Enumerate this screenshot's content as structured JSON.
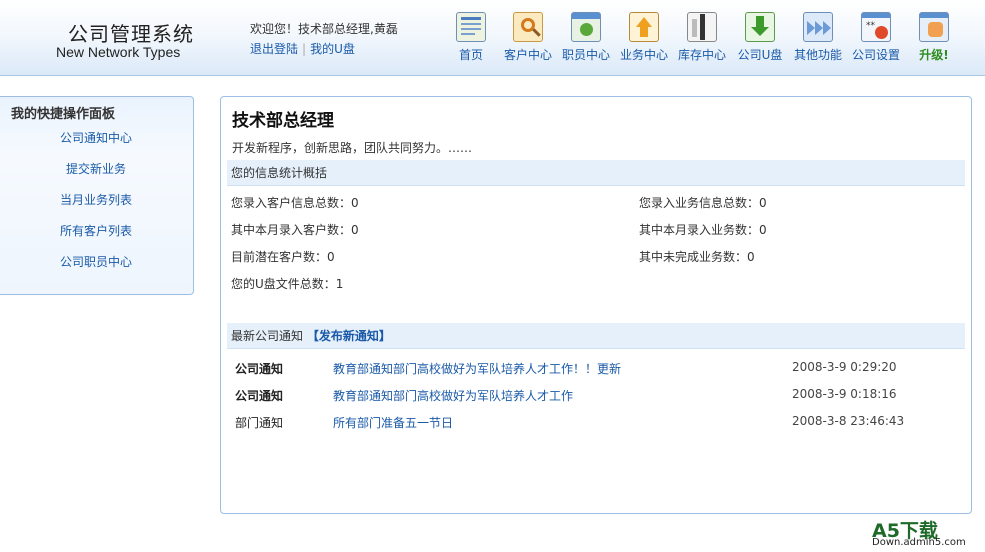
{
  "header": {
    "logo_cn": "公司管理系统",
    "logo_en": "New Network Types",
    "welcome": "欢迎您！技术部总经理,黄磊",
    "logout": "退出登陆",
    "separator": "|",
    "my_disk": "我的U盘",
    "nav": [
      {
        "label": "首页",
        "icon": "home-icon",
        "color": "#e8f0c8"
      },
      {
        "label": "客户中心",
        "icon": "customer-icon",
        "color": "#f5e2a8"
      },
      {
        "label": "职员中心",
        "icon": "staff-icon",
        "color": "#cfe8c8"
      },
      {
        "label": "业务中心",
        "icon": "business-icon",
        "color": "#f3c36a"
      },
      {
        "label": "库存中心",
        "icon": "inventory-icon",
        "color": "#dcdcdc"
      },
      {
        "label": "公司U盘",
        "icon": "usb-disk-icon",
        "color": "#9fd48a"
      },
      {
        "label": "其他功能",
        "icon": "other-functions-icon",
        "color": "#b8d2f0"
      },
      {
        "label": "公司设置",
        "icon": "settings-icon",
        "color": "#e9eef5"
      },
      {
        "label": "升级!",
        "icon": "upgrade-icon",
        "color": "#f6c27a"
      }
    ]
  },
  "quick_panel": {
    "title": "我的快捷操作面板",
    "items": [
      "公司通知中心",
      "提交新业务",
      "当月业务列表",
      "所有客户列表",
      "公司职员中心"
    ]
  },
  "main": {
    "title": "技术部总经理",
    "slogan": "开发新程序，创新思路，团队共同努力。……",
    "stats_header": "您的信息统计概括",
    "stats_left": [
      "您录入客户信息总数：0",
      "其中本月录入客户数：0",
      "目前潜在客户数：0",
      "您的U盘文件总数：1"
    ],
    "stats_right": [
      "您录入业务信息总数：0",
      "其中本月录入业务数：0",
      "其中未完成业务数：0"
    ],
    "notice_header": "最新公司通知",
    "publish_link": "【发布新通知】",
    "notices": [
      {
        "category": "公司通知",
        "title": "教育部通知部门高校做好为军队培养人才工作！！更新",
        "date": "2008-3-9 0:29:20"
      },
      {
        "category": "公司通知",
        "title": "教育部通知部门高校做好为军队培养人才工作",
        "date": "2008-3-9 0:18:16"
      },
      {
        "category": "部门通知",
        "title": "所有部门准备五一节日",
        "date": "2008-3-8 23:46:43"
      }
    ]
  },
  "watermark": {
    "big": "A5下载",
    "small": "Down.admin5.com"
  }
}
